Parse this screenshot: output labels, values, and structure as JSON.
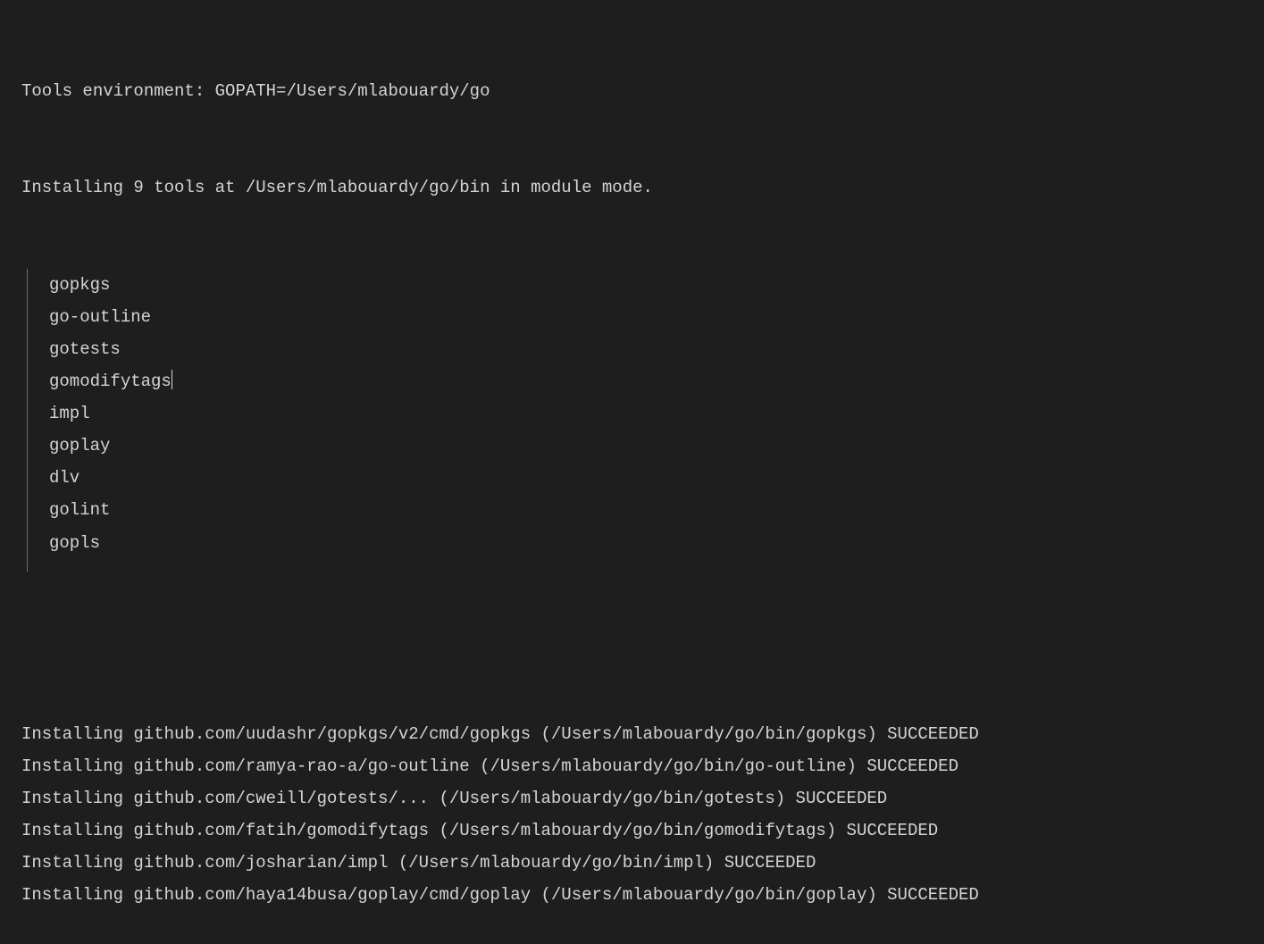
{
  "header": {
    "env_line": "Tools environment: GOPATH=/Users/mlabouardy/go",
    "install_summary": "Installing 9 tools at /Users/mlabouardy/go/bin in module mode."
  },
  "tools": [
    "gopkgs",
    "go-outline",
    "gotests",
    "gomodifytags",
    "impl",
    "goplay",
    "dlv",
    "golint",
    "gopls"
  ],
  "cursor_after_index": 3,
  "install_results": [
    "Installing github.com/uudashr/gopkgs/v2/cmd/gopkgs (/Users/mlabouardy/go/bin/gopkgs) SUCCEEDED",
    "Installing github.com/ramya-rao-a/go-outline (/Users/mlabouardy/go/bin/go-outline) SUCCEEDED",
    "Installing github.com/cweill/gotests/... (/Users/mlabouardy/go/bin/gotests) SUCCEEDED",
    "Installing github.com/fatih/gomodifytags (/Users/mlabouardy/go/bin/gomodifytags) SUCCEEDED",
    "Installing github.com/josharian/impl (/Users/mlabouardy/go/bin/impl) SUCCEEDED",
    "Installing github.com/haya14busa/goplay/cmd/goplay (/Users/mlabouardy/go/bin/goplay) SUCCEEDED"
  ]
}
